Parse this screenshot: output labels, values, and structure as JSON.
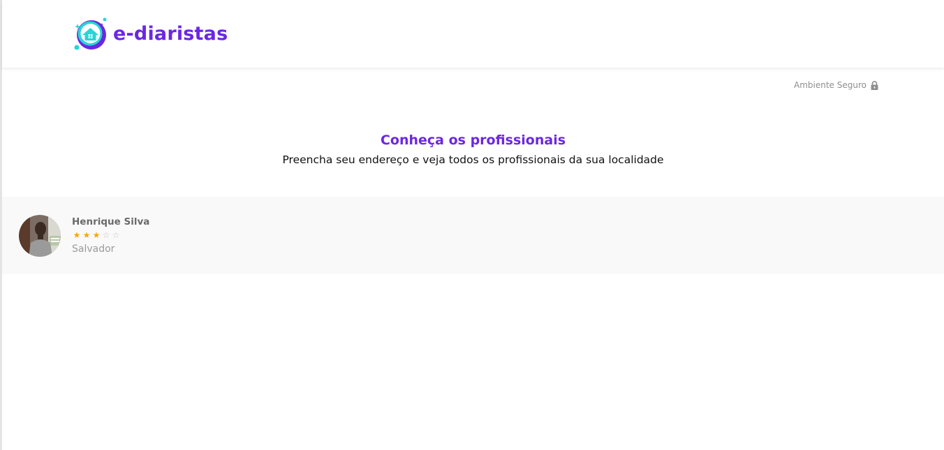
{
  "header": {
    "brand_name": "e-diaristas",
    "logo_icon": "house-logo-icon",
    "brand_color": "#6c27e2",
    "accent_color": "#27d6d6"
  },
  "secure_badge": {
    "label": "Ambiente Seguro",
    "icon": "lock-icon"
  },
  "main": {
    "title": "Conheça os profissionais",
    "subtitle": "Preencha seu endereço e veja todos os profissionais da sua localidade"
  },
  "professionals": [
    {
      "name": "Henrique Silva",
      "rating": 3,
      "max_rating": 5,
      "city": "Salvador",
      "avatar": "person-photo"
    }
  ],
  "colors": {
    "star_filled": "#f5a800",
    "star_empty": "#c4c4c4",
    "list_background": "#f9f9f9"
  }
}
